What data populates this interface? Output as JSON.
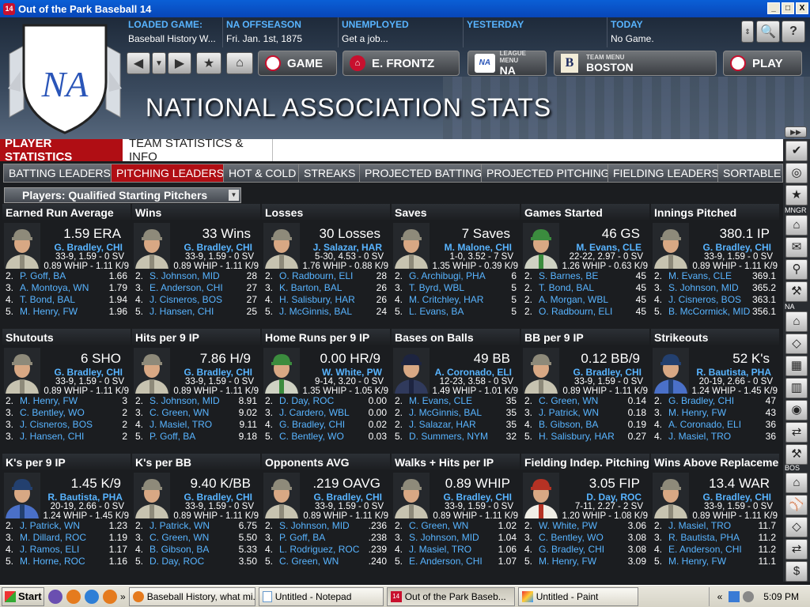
{
  "window": {
    "title": "Out of the Park Baseball 14",
    "min": "_",
    "max": "□",
    "close": "X"
  },
  "header": {
    "loaded_game": {
      "label": "LOADED GAME:",
      "value": "Baseball History W..."
    },
    "offseason": {
      "label": "NA OFFSEASON",
      "value": "Fri. Jan. 1st, 1875"
    },
    "status": {
      "label": "UNEMPLOYED",
      "value": "Get a job..."
    },
    "yesterday": {
      "label": "YESTERDAY",
      "value": ""
    },
    "today": {
      "label": "TODAY",
      "value": "No Game."
    },
    "game_btn": "GAME",
    "manager_btn": "E. FRONTZ",
    "league_menu_label": "LEAGUE MENU",
    "league_menu_value": "NA",
    "team_menu_label": "TEAM MENU",
    "team_menu_value": "BOSTON",
    "play_btn": "PLAY",
    "logo_text": "NA",
    "page_title": "NATIONAL ASSOCIATION STATS"
  },
  "tabs_main": [
    "PLAYER STATISTICS",
    "TEAM STATISTICS & INFO"
  ],
  "tabs_sub": [
    "BATTING LEADERS",
    "PITCHING LEADERS",
    "HOT & COLD",
    "STREAKS",
    "PROJECTED BATTING",
    "PROJECTED PITCHING",
    "FIELDING LEADERS",
    "SORTABLE S"
  ],
  "filter": "Players: Qualified Starting Pitchers",
  "sidebar_labels": {
    "mngr": "MNGR",
    "na": "NA",
    "bos": "BOS"
  },
  "cards": [
    {
      "title": "Earned Run Average",
      "stat": "1.59 ERA",
      "name": "G. Bradley, CHI",
      "l1": "33-9, 1.59 - 0 SV",
      "l2": "0.89 WHIP - 1.11 K/9",
      "portrait": "standard",
      "ranks": [
        [
          "2.",
          "P. Goff, BA",
          "1.66"
        ],
        [
          "3.",
          "A. Montoya, WN",
          "1.79"
        ],
        [
          "4.",
          "T. Bond, BAL",
          "1.94"
        ],
        [
          "5.",
          "M. Henry, FW",
          "1.96"
        ]
      ]
    },
    {
      "title": "Wins",
      "stat": "33 Wins",
      "name": "G. Bradley, CHI",
      "l1": "33-9, 1.59 - 0 SV",
      "l2": "0.89 WHIP - 1.11 K/9",
      "portrait": "standard",
      "ranks": [
        [
          "2.",
          "S. Johnson, MID",
          "28"
        ],
        [
          "3.",
          "E. Anderson, CHI",
          "27"
        ],
        [
          "4.",
          "J. Cisneros, BOS",
          "27"
        ],
        [
          "5.",
          "J. Hansen, CHI",
          "25"
        ]
      ]
    },
    {
      "title": "Losses",
      "stat": "30 Losses",
      "name": "J. Salazar, HAR",
      "l1": "5-30, 4.53 - 0 SV",
      "l2": "1.76 WHIP - 0.88 K/9",
      "portrait": "standard",
      "ranks": [
        [
          "2.",
          "O. Radbourn, ELI",
          "28"
        ],
        [
          "3.",
          "K. Barton, BAL",
          "26"
        ],
        [
          "4.",
          "H. Salisbury, HAR",
          "26"
        ],
        [
          "5.",
          "J. McGinnis, BAL",
          "24"
        ]
      ]
    },
    {
      "title": "Saves",
      "stat": "7 Saves",
      "name": "M. Malone, CHI",
      "l1": "1-0, 3.52 - 7 SV",
      "l2": "1.35 WHIP - 0.39 K/9",
      "portrait": "standard",
      "ranks": [
        [
          "2.",
          "G. Archibugi, PHA",
          "6"
        ],
        [
          "3.",
          "T. Byrd, WBL",
          "5"
        ],
        [
          "4.",
          "M. Critchley, HAR",
          "5"
        ],
        [
          "5.",
          "L. Evans, BA",
          "5"
        ]
      ]
    },
    {
      "title": "Games Started",
      "stat": "46 GS",
      "name": "M. Evans, CLE",
      "l1": "22-22, 2.97 - 0 SV",
      "l2": "1.26 WHIP - 0.63 K/9",
      "portrait": "green",
      "ranks": [
        [
          "2.",
          "S. Barnes, BE",
          "45"
        ],
        [
          "2.",
          "T. Bond, BAL",
          "45"
        ],
        [
          "2.",
          "A. Morgan, WBL",
          "45"
        ],
        [
          "2.",
          "O. Radbourn, ELI",
          "45"
        ]
      ]
    },
    {
      "title": "Innings Pitched",
      "stat": "380.1 IP",
      "name": "G. Bradley, CHI",
      "l1": "33-9, 1.59 - 0 SV",
      "l2": "0.89 WHIP - 1.11 K/9",
      "portrait": "standard",
      "ranks": [
        [
          "2.",
          "M. Evans, CLE",
          "369.1"
        ],
        [
          "3.",
          "S. Johnson, MID",
          "365.2"
        ],
        [
          "4.",
          "J. Cisneros, BOS",
          "363.1"
        ],
        [
          "5.",
          "B. McCormick, MID",
          "356.1"
        ]
      ]
    },
    {
      "title": "Shutouts",
      "stat": "6 SHO",
      "name": "G. Bradley, CHI",
      "l1": "33-9, 1.59 - 0 SV",
      "l2": "0.89 WHIP - 1.11 K/9",
      "portrait": "standard",
      "ranks": [
        [
          "2.",
          "M. Henry, FW",
          "3"
        ],
        [
          "3.",
          "C. Bentley, WO",
          "2"
        ],
        [
          "3.",
          "J. Cisneros, BOS",
          "2"
        ],
        [
          "3.",
          "J. Hansen, CHI",
          "2"
        ]
      ]
    },
    {
      "title": "Hits per 9 IP",
      "stat": "7.86 H/9",
      "name": "G. Bradley, CHI",
      "l1": "33-9, 1.59 - 0 SV",
      "l2": "0.89 WHIP - 1.11 K/9",
      "portrait": "standard",
      "ranks": [
        [
          "2.",
          "S. Johnson, MID",
          "8.91"
        ],
        [
          "3.",
          "C. Green, WN",
          "9.02"
        ],
        [
          "4.",
          "J. Masiel, TRO",
          "9.11"
        ],
        [
          "5.",
          "P. Goff, BA",
          "9.18"
        ]
      ]
    },
    {
      "title": "Home Runs per 9 IP",
      "stat": "0.00 HR/9",
      "name": "W. White, PW",
      "l1": "9-14, 3.20 - 0 SV",
      "l2": "1.35 WHIP - 1.05 K/9",
      "portrait": "green",
      "ranks": [
        [
          "2.",
          "D. Day, ROC",
          "0.00"
        ],
        [
          "3.",
          "J. Cardero, WBL",
          "0.00"
        ],
        [
          "4.",
          "G. Bradley, CHI",
          "0.02"
        ],
        [
          "5.",
          "C. Bentley, WO",
          "0.03"
        ]
      ]
    },
    {
      "title": "Bases on Balls",
      "stat": "49 BB",
      "name": "A. Coronado, ELI",
      "l1": "12-23, 3.58 - 0 SV",
      "l2": "1.49 WHIP - 1.01 K/9",
      "portrait": "navy",
      "ranks": [
        [
          "2.",
          "M. Evans, CLE",
          "35"
        ],
        [
          "2.",
          "J. McGinnis, BAL",
          "35"
        ],
        [
          "2.",
          "J. Salazar, HAR",
          "35"
        ],
        [
          "5.",
          "D. Summers, NYM",
          "32"
        ]
      ]
    },
    {
      "title": "BB per 9 IP",
      "stat": "0.12 BB/9",
      "name": "G. Bradley, CHI",
      "l1": "33-9, 1.59 - 0 SV",
      "l2": "0.89 WHIP - 1.11 K/9",
      "portrait": "standard",
      "ranks": [
        [
          "2.",
          "C. Green, WN",
          "0.14"
        ],
        [
          "3.",
          "J. Patrick, WN",
          "0.18"
        ],
        [
          "4.",
          "B. Gibson, BA",
          "0.19"
        ],
        [
          "5.",
          "H. Salisbury, HAR",
          "0.27"
        ]
      ]
    },
    {
      "title": "Strikeouts",
      "stat": "52 K's",
      "name": "R. Bautista, PHA",
      "l1": "20-19, 2.66 - 0 SV",
      "l2": "1.24 WHIP - 1.45 K/9",
      "portrait": "blue",
      "ranks": [
        [
          "2.",
          "G. Bradley, CHI",
          "47"
        ],
        [
          "3.",
          "M. Henry, FW",
          "43"
        ],
        [
          "4.",
          "A. Coronado, ELI",
          "36"
        ],
        [
          "4.",
          "J. Masiel, TRO",
          "36"
        ]
      ]
    },
    {
      "title": "K's per 9 IP",
      "stat": "1.45 K/9",
      "name": "R. Bautista, PHA",
      "l1": "20-19, 2.66 - 0 SV",
      "l2": "1.24 WHIP - 1.45 K/9",
      "portrait": "blue",
      "ranks": [
        [
          "2.",
          "J. Patrick, WN",
          "1.23"
        ],
        [
          "3.",
          "M. Dillard, ROC",
          "1.19"
        ],
        [
          "4.",
          "J. Ramos, ELI",
          "1.17"
        ],
        [
          "5.",
          "M. Horne, ROC",
          "1.16"
        ]
      ]
    },
    {
      "title": "K's per BB",
      "stat": "9.40 K/BB",
      "name": "G. Bradley, CHI",
      "l1": "33-9, 1.59 - 0 SV",
      "l2": "0.89 WHIP - 1.11 K/9",
      "portrait": "standard",
      "ranks": [
        [
          "2.",
          "J. Patrick, WN",
          "6.75"
        ],
        [
          "3.",
          "C. Green, WN",
          "5.50"
        ],
        [
          "4.",
          "B. Gibson, BA",
          "5.33"
        ],
        [
          "5.",
          "D. Day, ROC",
          "3.50"
        ]
      ]
    },
    {
      "title": "Opponents AVG",
      "stat": ".219 OAVG",
      "name": "G. Bradley, CHI",
      "l1": "33-9, 1.59 - 0 SV",
      "l2": "0.89 WHIP - 1.11 K/9",
      "portrait": "standard",
      "ranks": [
        [
          "2.",
          "S. Johnson, MID",
          ".236"
        ],
        [
          "3.",
          "P. Goff, BA",
          ".238"
        ],
        [
          "4.",
          "L. Rodriguez, ROC",
          ".239"
        ],
        [
          "5.",
          "C. Green, WN",
          ".240"
        ]
      ]
    },
    {
      "title": "Walks + Hits per IP",
      "stat": "0.89 WHIP",
      "name": "G. Bradley, CHI",
      "l1": "33-9, 1.59 - 0 SV",
      "l2": "0.89 WHIP - 1.11 K/9",
      "portrait": "standard",
      "ranks": [
        [
          "2.",
          "C. Green, WN",
          "1.02"
        ],
        [
          "3.",
          "S. Johnson, MID",
          "1.04"
        ],
        [
          "4.",
          "J. Masiel, TRO",
          "1.06"
        ],
        [
          "5.",
          "E. Anderson, CHI",
          "1.07"
        ]
      ]
    },
    {
      "title": "Fielding Indep. Pitching",
      "stat": "3.05 FIP",
      "name": "D. Day, ROC",
      "l1": "7-11, 2.27 - 2 SV",
      "l2": "1.20 WHIP - 1.08 K/9",
      "portrait": "red",
      "ranks": [
        [
          "2.",
          "W. White, PW",
          "3.06"
        ],
        [
          "3.",
          "C. Bentley, WO",
          "3.08"
        ],
        [
          "4.",
          "G. Bradley, CHI",
          "3.08"
        ],
        [
          "5.",
          "M. Henry, FW",
          "3.09"
        ]
      ]
    },
    {
      "title": "Wins Above Replacement",
      "stat": "13.4 WAR",
      "name": "G. Bradley, CHI",
      "l1": "33-9, 1.59 - 0 SV",
      "l2": "0.89 WHIP - 1.11 K/9",
      "portrait": "standard",
      "ranks": [
        [
          "2.",
          "J. Masiel, TRO",
          "11.7"
        ],
        [
          "3.",
          "R. Bautista, PHA",
          "11.2"
        ],
        [
          "4.",
          "E. Anderson, CHI",
          "11.2"
        ],
        [
          "5.",
          "M. Henry, FW",
          "11.1"
        ]
      ]
    }
  ],
  "taskbar": {
    "start": "Start",
    "tasks": [
      "Baseball History, what mi...",
      "Untitled - Notepad",
      "Out of the Park Baseb...",
      "Untitled - Paint"
    ],
    "time": "5:09 PM",
    "expand": "«",
    "more": "»"
  }
}
